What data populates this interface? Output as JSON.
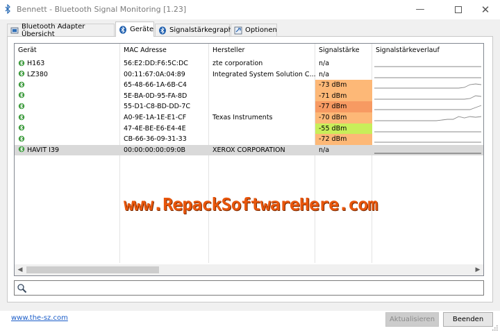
{
  "window": {
    "title": "Bennett - Bluetooth Signal Monitoring [1.23]",
    "min_glyph": "—",
    "close_glyph": "✕"
  },
  "tabs": [
    {
      "label": "Bluetooth Adapter Übersicht",
      "icon": "adapter-icon"
    },
    {
      "label": "Geräte",
      "icon": "bluetooth-icon",
      "active": true
    },
    {
      "label": "Signalstärkegraph",
      "icon": "bluetooth-icon"
    },
    {
      "label": "Optionen",
      "icon": "options-icon"
    }
  ],
  "table": {
    "columns": [
      "Gerät",
      "MAC Adresse",
      "Hersteller",
      "Signalstärke",
      "Signalstärkeverlauf"
    ],
    "rows": [
      {
        "device": "H163",
        "mac": "56:E2:DD:F6:5C:DC",
        "vendor": "zte corporation",
        "signal": "n/a",
        "signal_color": "",
        "history": [
          0,
          0,
          0,
          0,
          0,
          0,
          0,
          0,
          0,
          0,
          0,
          0,
          0,
          0,
          0,
          0,
          0,
          0,
          0,
          0
        ],
        "selected": false
      },
      {
        "device": "LZ380",
        "mac": "00:11:67:0A:04:89",
        "vendor": "Integrated System Solution C...",
        "signal": "n/a",
        "signal_color": "",
        "history": [
          0,
          0,
          0,
          0,
          0,
          0,
          0,
          0,
          0,
          0,
          0,
          0,
          0,
          0,
          0,
          0,
          0,
          0,
          0,
          0
        ],
        "selected": false
      },
      {
        "device": "",
        "mac": "65-48-66-1A-6B-C4",
        "vendor": "",
        "signal": "-73 dBm",
        "signal_color": "#fdb877",
        "history": [
          0,
          0,
          0,
          0,
          0,
          0,
          0,
          0,
          0,
          0,
          0,
          0,
          0,
          0,
          0,
          0,
          1,
          5,
          6,
          5
        ],
        "selected": false
      },
      {
        "device": "",
        "mac": "5E-BA-0D-95-FA-8D",
        "vendor": "",
        "signal": "-71 dBm",
        "signal_color": "#fdb877",
        "history": [
          0,
          0,
          0,
          0,
          0,
          0,
          0,
          0,
          0,
          0,
          0,
          0,
          0,
          0,
          0,
          0,
          0,
          1,
          5,
          4
        ],
        "selected": false
      },
      {
        "device": "",
        "mac": "55-D1-C8-BD-DD-7C",
        "vendor": "",
        "signal": "-77 dBm",
        "signal_color": "#f79a62",
        "history": [
          0,
          0,
          0,
          0,
          0,
          0,
          0,
          0,
          0,
          0,
          0,
          0,
          0,
          0,
          0,
          0,
          0,
          0,
          3,
          6
        ],
        "selected": false
      },
      {
        "device": "",
        "mac": "A0-9E-1A-1E-E1-CF",
        "vendor": "Texas Instruments",
        "signal": "-70 dBm",
        "signal_color": "#fdb877",
        "history": [
          0,
          0,
          0,
          0,
          0,
          0,
          0,
          0,
          0,
          0,
          0,
          0,
          1,
          2,
          2,
          6,
          4,
          6,
          5,
          6
        ],
        "selected": false
      },
      {
        "device": "",
        "mac": "47-4E-BE-E6-E4-4E",
        "vendor": "",
        "signal": "-55 dBm",
        "signal_color": "#c8ee5a",
        "history": [
          0,
          0,
          0,
          0,
          0,
          0,
          0,
          0,
          0,
          0,
          0,
          0,
          0,
          0,
          0,
          0,
          0,
          0,
          0,
          0
        ],
        "selected": false
      },
      {
        "device": "",
        "mac": "CB-66-36-09-31-33",
        "vendor": "",
        "signal": "-72 dBm",
        "signal_color": "#fdb877",
        "history": [
          0,
          0,
          0,
          0,
          0,
          0,
          0,
          0,
          0,
          0,
          0,
          0,
          0,
          0,
          0,
          0,
          0,
          0,
          0,
          0
        ],
        "selected": false
      },
      {
        "device": "HAVIT I39",
        "mac": "00:00:00:00:09:0B",
        "vendor": "XEROX CORPORATION",
        "signal": "n/a",
        "signal_color": "",
        "history": [
          0,
          0,
          0,
          0,
          0,
          0,
          0,
          0,
          0,
          0,
          0,
          0,
          0,
          0,
          0,
          0,
          0,
          0,
          0,
          0
        ],
        "selected": true
      }
    ]
  },
  "watermark": "www.RepackSoftwareHere.com",
  "search": {
    "value": "",
    "placeholder": ""
  },
  "footer": {
    "link": "www.the-sz.com",
    "update_button": "Aktualisieren",
    "close_button": "Beenden"
  }
}
